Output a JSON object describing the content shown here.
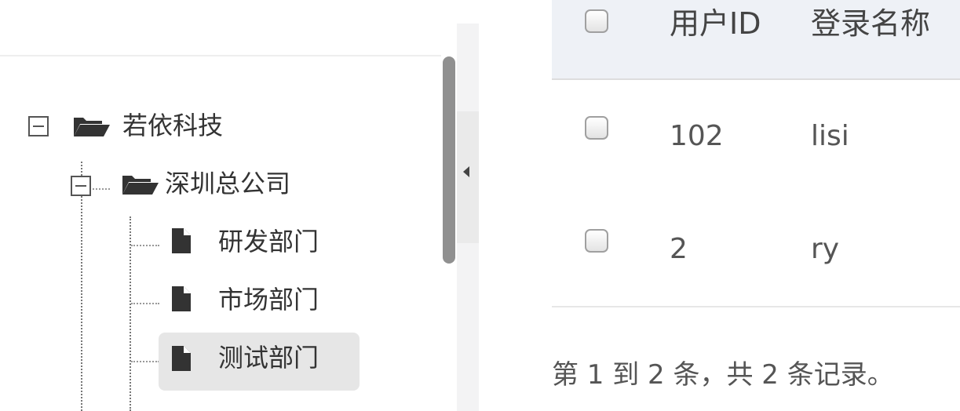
{
  "tree": {
    "root": {
      "label": "若依科技",
      "expanded": true
    },
    "child": {
      "label": "深圳总公司",
      "expanded": true
    },
    "departments": [
      {
        "label": "研发部门",
        "selected": false
      },
      {
        "label": "市场部门",
        "selected": false
      },
      {
        "label": "测试部门",
        "selected": true
      }
    ]
  },
  "table": {
    "columns": [
      "用户ID",
      "登录名称"
    ],
    "rows": [
      {
        "user_id": "102",
        "login_name": "lisi"
      },
      {
        "user_id": "2",
        "login_name": "ry"
      }
    ]
  },
  "pagination": {
    "info": "第 1 到 2 条，共 2 条记录。"
  },
  "icons": {
    "expand": "minus-square-icon",
    "folder": "folder-open-icon",
    "file": "file-icon",
    "collapse": "caret-left-icon"
  },
  "colors": {
    "header_bg": "#eef1f6",
    "selected_bg": "#e6e6e6",
    "scrollbar": "#909090"
  }
}
